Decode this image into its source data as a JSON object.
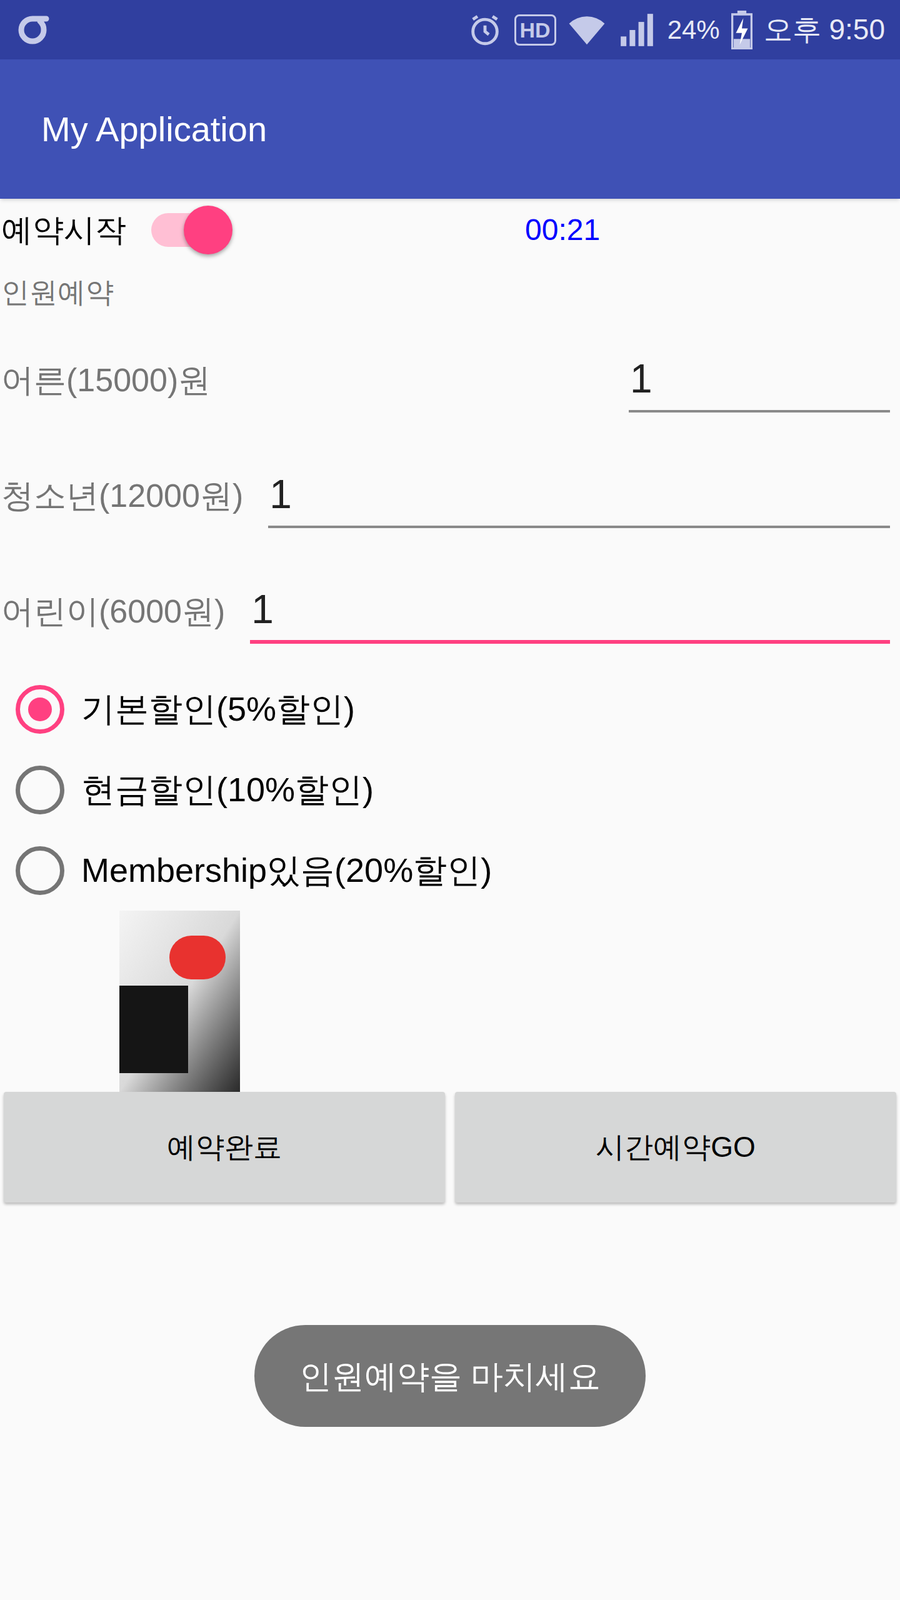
{
  "status_bar": {
    "hd": "HD",
    "battery": "24%",
    "battery_charging": true,
    "time": "오후 9:50"
  },
  "app_bar": {
    "title": "My Application"
  },
  "reservation_switch": {
    "label": "예약시작",
    "on": true
  },
  "timer": "00:21",
  "section_label": "인원예약",
  "fields": [
    {
      "label": "어른(15000)원",
      "value": "1",
      "focused": false
    },
    {
      "label": "청소년(12000원)",
      "value": "1",
      "focused": false
    },
    {
      "label": "어린이(6000원)",
      "value": "1",
      "focused": true
    }
  ],
  "discounts": [
    {
      "label": "기본할인(5%할인)",
      "selected": true
    },
    {
      "label": "현금할인(10%할인)",
      "selected": false
    },
    {
      "label": "Membership있음(20%할인)",
      "selected": false
    }
  ],
  "buttons": [
    "예약완료",
    "시간예약GO"
  ],
  "toast": "인원예약을 마치세요"
}
